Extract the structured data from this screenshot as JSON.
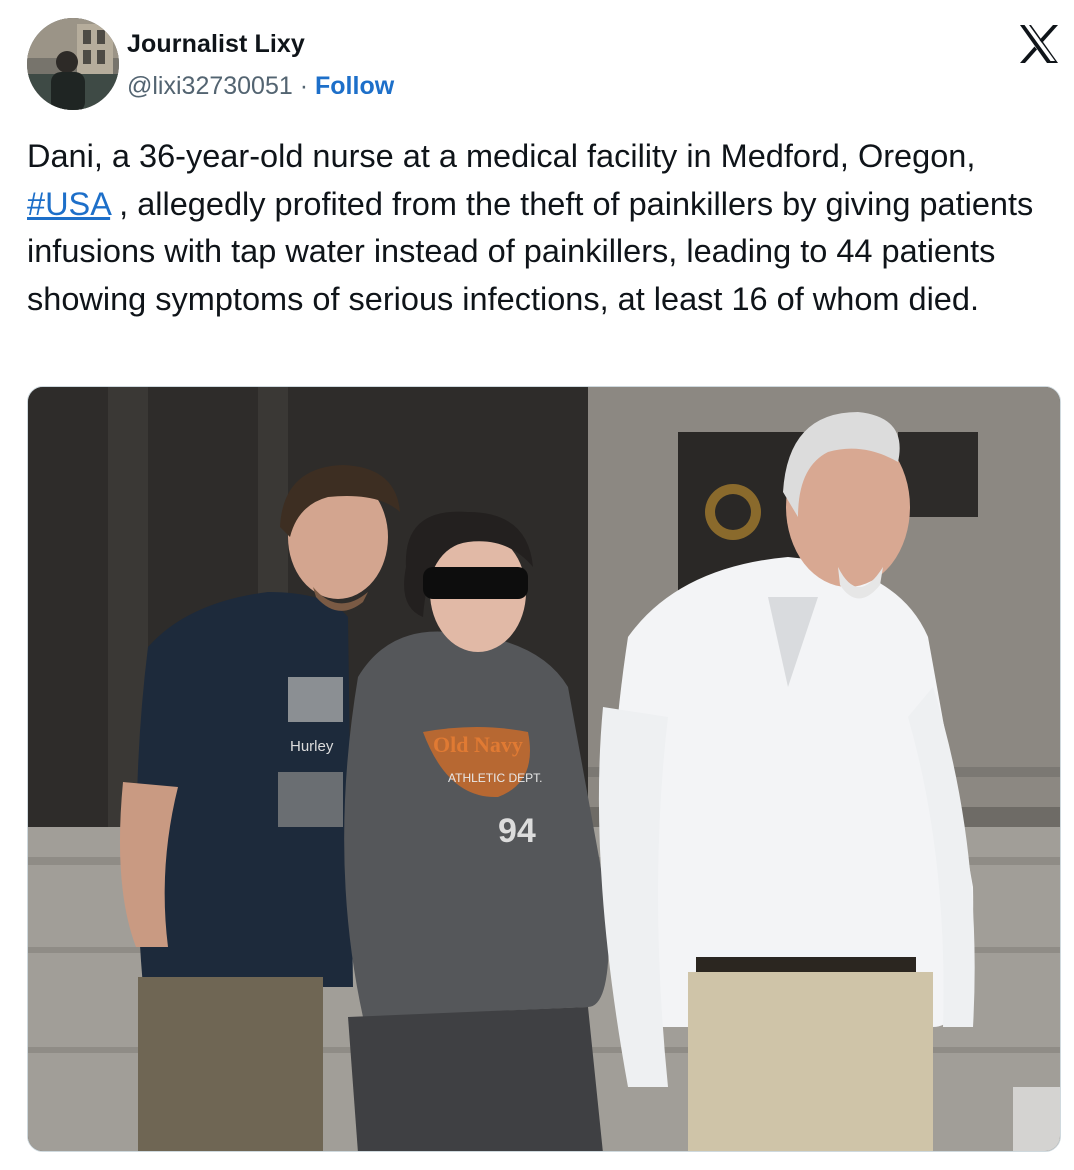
{
  "author": {
    "name": "Journalist Lixy",
    "handle": "@lixi32730051",
    "separator": "·",
    "follow_label": "Follow"
  },
  "logo_icon": "x-logo-icon",
  "tweet": {
    "text_before": "Dani, a 36-year-old nurse at a medical facility in Medford, Oregon, ",
    "hashtag": "#USA",
    "text_after": " , allegedly profited from the theft of painkillers by giving patients infusions with tap water instead of painkillers, leading to 44 patients showing symptoms of serious infections, at least 16 of whom died."
  },
  "photo": {
    "shirt_brand": "Hurley",
    "hoodie_text_1": "Old Navy",
    "hoodie_text_2": "ATHLETIC DEPT.",
    "hoodie_number": "94"
  },
  "colors": {
    "link": "#1d6fc9",
    "text": "#0f1419",
    "secondary": "#536471"
  }
}
